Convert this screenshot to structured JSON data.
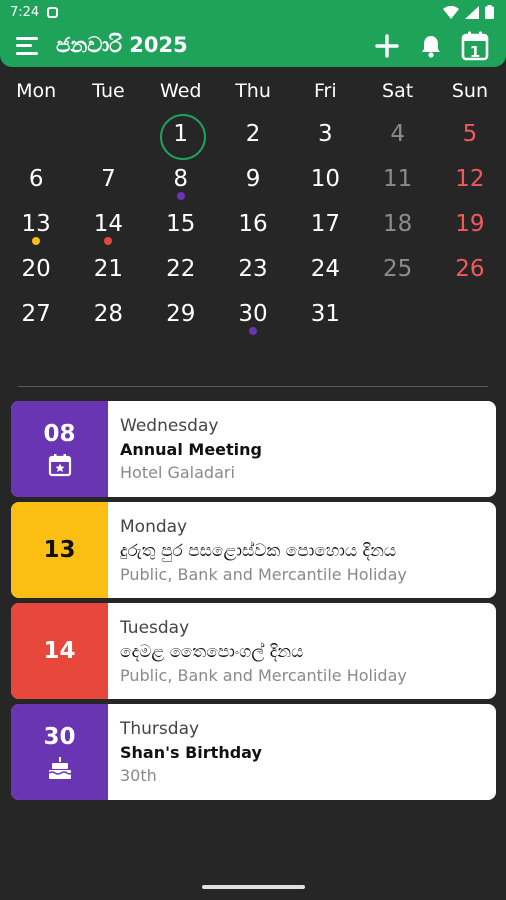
{
  "status": {
    "time": "7:24"
  },
  "header": {
    "title": "ජනවාරි 2025",
    "calendar_badge": "1"
  },
  "weekdays": [
    "Mon",
    "Tue",
    "Wed",
    "Thu",
    "Fri",
    "Sat",
    "Sun"
  ],
  "calendar": {
    "days": [
      "",
      "",
      "1",
      "2",
      "3",
      "4",
      "5",
      "6",
      "7",
      "8",
      "9",
      "10",
      "11",
      "12",
      "13",
      "14",
      "15",
      "16",
      "17",
      "18",
      "19",
      "20",
      "21",
      "22",
      "23",
      "24",
      "25",
      "26",
      "27",
      "28",
      "29",
      "30",
      "31",
      "",
      ""
    ],
    "today": "1"
  },
  "colors": {
    "accent": "#1fa35a",
    "purple": "#6a35b3",
    "yellow": "#fbbe12",
    "red": "#e8473b",
    "sunday": "#f05a5a"
  },
  "events": [
    {
      "date": "08",
      "day": "Wednesday",
      "title": "Annual Meeting",
      "sub": "Hotel Galadari",
      "color": "#6a35b3",
      "icon": "event-star-icon"
    },
    {
      "date": "13",
      "day": "Monday",
      "title": "දුරුතු පුර පසළොස්වක පොහොය දිනය",
      "sub": "Public, Bank and Mercantile Holiday",
      "color": "#fbbe12",
      "icon": ""
    },
    {
      "date": "14",
      "day": "Tuesday",
      "title": "දෙමළ තෛපොංගල් දිනය",
      "sub": "Public, Bank and Mercantile Holiday",
      "color": "#e8473b",
      "icon": ""
    },
    {
      "date": "30",
      "day": "Thursday",
      "title": "Shan's Birthday",
      "sub": "30th",
      "color": "#6a35b3",
      "icon": "cake-icon"
    }
  ]
}
